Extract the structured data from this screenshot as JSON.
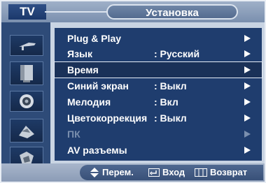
{
  "header": {
    "source": "TV",
    "title": "Установка"
  },
  "sidebar_icons": [
    {
      "name": "antenna-icon"
    },
    {
      "name": "picture-icon"
    },
    {
      "name": "speaker-icon"
    },
    {
      "name": "channel-icon"
    },
    {
      "name": "setup-icon"
    }
  ],
  "menu": {
    "items": [
      {
        "label": "Plug & Play",
        "value": "",
        "selected": false,
        "enabled": true
      },
      {
        "label": "Язык",
        "value": ": Русский",
        "selected": false,
        "enabled": true
      },
      {
        "label": "Время",
        "value": "",
        "selected": true,
        "enabled": true
      },
      {
        "label": "Синий экран",
        "value": ": Выкл",
        "selected": false,
        "enabled": true
      },
      {
        "label": "Мелодия",
        "value": ": Вкл",
        "selected": false,
        "enabled": true
      },
      {
        "label": "Цветокоррекция",
        "value": ": Выкл",
        "selected": false,
        "enabled": true
      },
      {
        "label": "ПК",
        "value": "",
        "selected": false,
        "enabled": false
      },
      {
        "label": "AV разъемы",
        "value": "",
        "selected": false,
        "enabled": true
      }
    ]
  },
  "footer": {
    "move": "Перем.",
    "enter": "Вход",
    "return": "Возврат"
  }
}
